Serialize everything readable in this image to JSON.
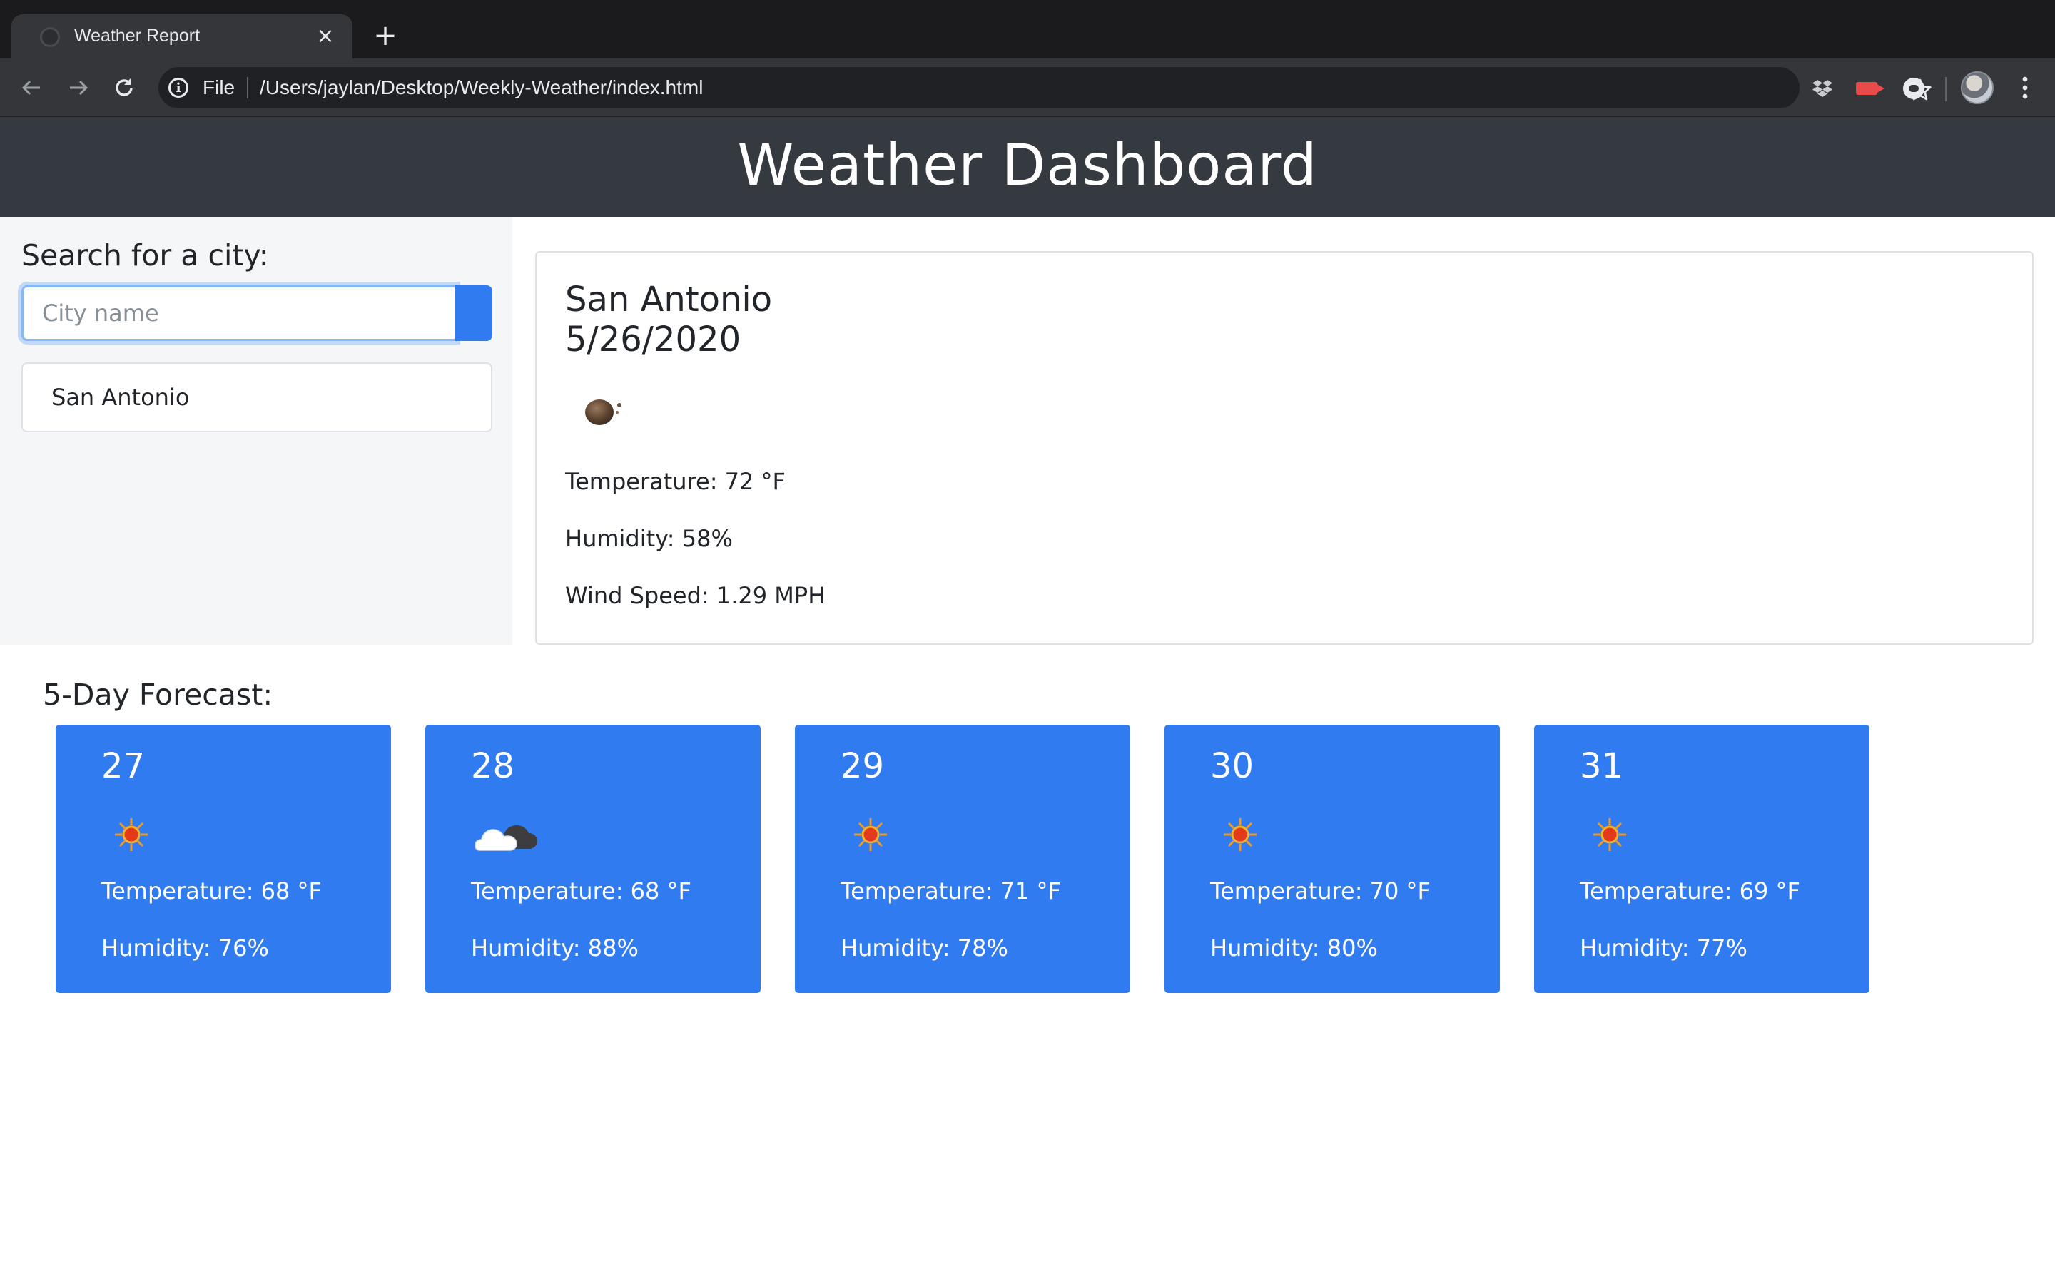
{
  "browser": {
    "tab_title": "Weather Report",
    "close_glyph": "×",
    "new_tab_glyph": "+",
    "url_scheme": "File",
    "url_path": "/Users/jaylan/Desktop/Weekly-Weather/index.html",
    "icons": [
      "back-arrow-icon",
      "forward-arrow-icon",
      "reload-icon",
      "info-icon",
      "star-icon",
      "dropbox-icon",
      "extension-icon",
      "extension-icon",
      "avatar",
      "menu-icon"
    ]
  },
  "header": {
    "title": "Weather Dashboard",
    "background": "#343a40"
  },
  "search": {
    "label": "Search for a city:",
    "placeholder": "City name",
    "value": "",
    "button_color": "#2f7bef"
  },
  "history": {
    "items": [
      "San Antonio"
    ]
  },
  "current": {
    "city": "San Antonio",
    "date": "5/26/2020",
    "icon": "brown-dot-weather-icon",
    "temperature": "Temperature: 72 °F",
    "humidity": "Humidity: 58%",
    "wind": "Wind Speed: 1.29 MPH"
  },
  "forecast": {
    "heading": "5-Day Forecast:",
    "card_color": "#2f7bef",
    "days": [
      {
        "day": "27",
        "icon": "sun-icon",
        "temperature": "Temperature: 68 °F",
        "humidity": "Humidity: 76%"
      },
      {
        "day": "28",
        "icon": "cloud-icon",
        "temperature": "Temperature: 68 °F",
        "humidity": "Humidity: 88%"
      },
      {
        "day": "29",
        "icon": "sun-icon",
        "temperature": "Temperature: 71 °F",
        "humidity": "Humidity: 78%"
      },
      {
        "day": "30",
        "icon": "sun-icon",
        "temperature": "Temperature: 70 °F",
        "humidity": "Humidity: 80%"
      },
      {
        "day": "31",
        "icon": "sun-icon",
        "temperature": "Temperature: 69 °F",
        "humidity": "Humidity: 77%"
      }
    ]
  }
}
